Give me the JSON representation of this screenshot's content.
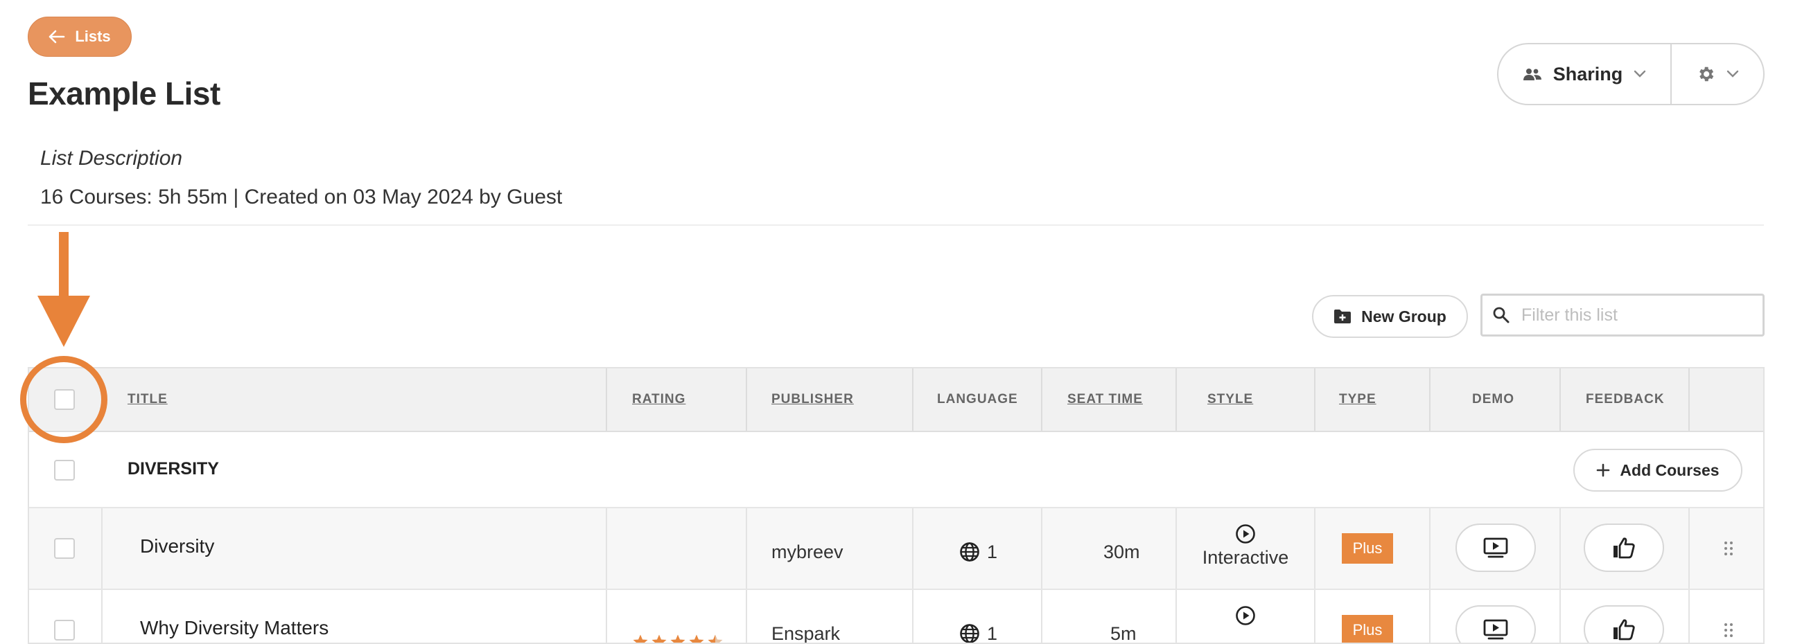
{
  "header": {
    "back_label": "Lists",
    "title": "Example List",
    "description": "List Description",
    "meta": "16 Courses: 5h 55m | Created on 03 May 2024 by Guest",
    "sharing_label": "Sharing"
  },
  "toolbar": {
    "new_group_label": "New Group",
    "filter_placeholder": "Filter this list"
  },
  "table": {
    "columns": {
      "title": "TITLE",
      "rating": "RATING",
      "publisher": "PUBLISHER",
      "language": "LANGUAGE",
      "seat_time": "SEAT TIME",
      "style": "STYLE",
      "type": "TYPE",
      "demo": "DEMO",
      "feedback": "FEEDBACK"
    },
    "group": {
      "name": "DIVERSITY",
      "add_courses_label": "Add Courses"
    },
    "rows": [
      {
        "title": "Diversity",
        "rating": 0,
        "publisher": "mybreev",
        "language_count": "1",
        "seat_time": "30m",
        "style": "Interactive",
        "type": "Plus"
      },
      {
        "title": "Why Diversity Matters",
        "rating": 4.5,
        "publisher": "Enspark",
        "language_count": "1",
        "seat_time": "5m",
        "style": "",
        "type": "Plus"
      }
    ]
  },
  "colors": {
    "accent": "#e8883f",
    "back_button": "#e8955e",
    "annotation": "#e8833a"
  }
}
